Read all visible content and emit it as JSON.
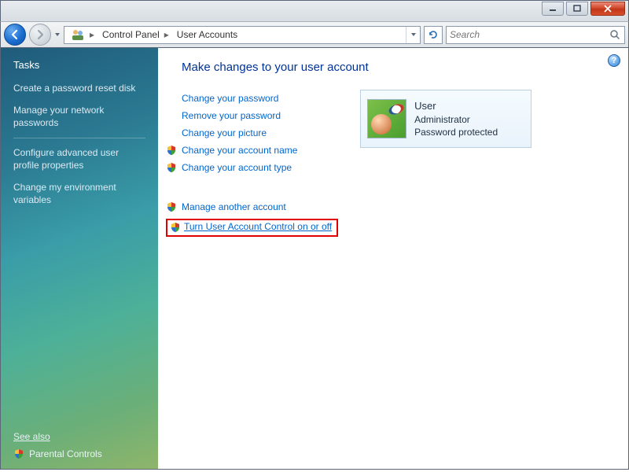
{
  "breadcrumb": {
    "root_icon_name": "user-accounts-icon",
    "segments": [
      "Control Panel",
      "User Accounts"
    ]
  },
  "search": {
    "placeholder": "Search"
  },
  "sidebar": {
    "heading": "Tasks",
    "links": [
      "Create a password reset disk",
      "Manage your network passwords",
      "Configure advanced user profile properties",
      "Change my environment variables"
    ],
    "see_also_heading": "See also",
    "see_also": [
      "Parental Controls"
    ]
  },
  "main": {
    "heading": "Make changes to your user account",
    "links_group1": [
      {
        "label": "Change your password",
        "shield": false
      },
      {
        "label": "Remove your password",
        "shield": false
      },
      {
        "label": "Change your picture",
        "shield": false
      },
      {
        "label": "Change your account name",
        "shield": true
      },
      {
        "label": "Change your account type",
        "shield": true
      }
    ],
    "links_group2": [
      {
        "label": "Manage another account",
        "shield": true
      },
      {
        "label": "Turn User Account Control on or off",
        "shield": true,
        "highlighted": true
      }
    ]
  },
  "account": {
    "name": "User",
    "role": "Administrator",
    "status": "Password protected"
  },
  "help_tooltip": "?"
}
